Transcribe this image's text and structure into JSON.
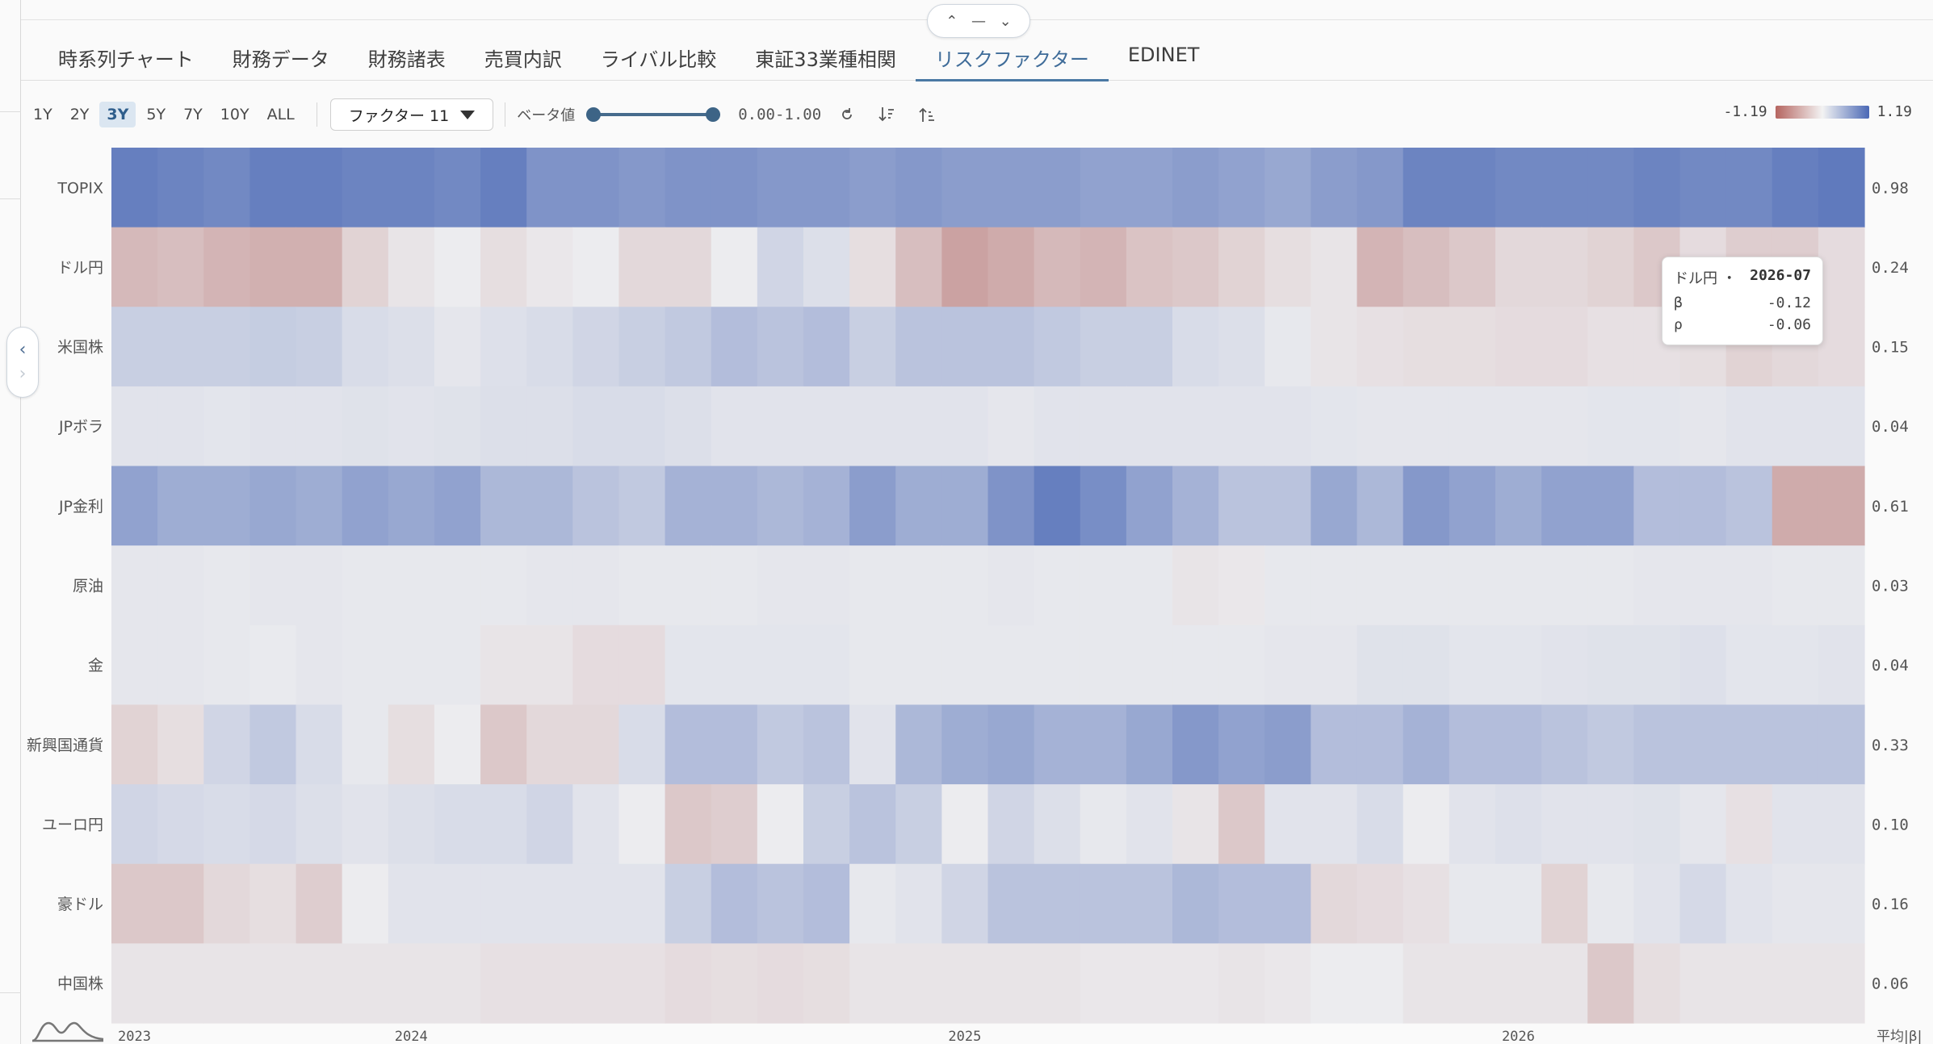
{
  "tabs": [
    {
      "label": "時系列チャート",
      "active": false
    },
    {
      "label": "財務データ",
      "active": false
    },
    {
      "label": "財務諸表",
      "active": false
    },
    {
      "label": "売買内訳",
      "active": false
    },
    {
      "label": "ライバル比較",
      "active": false
    },
    {
      "label": "東証33業種相関",
      "active": false
    },
    {
      "label": "リスクファクター",
      "active": true
    },
    {
      "label": "EDINET",
      "active": false
    }
  ],
  "toolbar": {
    "periods": [
      "1Y",
      "2Y",
      "3Y",
      "5Y",
      "7Y",
      "10Y",
      "ALL"
    ],
    "active_period": "3Y",
    "factor_select": "ファクター 11",
    "beta_label": "ベータ値",
    "range": {
      "min": 0.0,
      "max": 1.0
    },
    "range_text": "0.00-1.00"
  },
  "legend": {
    "min_label": "-1.19",
    "max_label": "1.19",
    "neg_color": "#b56560",
    "mid_color": "#f3f3f3",
    "pos_color": "#4a68b5"
  },
  "tooltip": {
    "factor": "ドル円",
    "dot": "・",
    "date": "2026-07",
    "beta_label": "β",
    "beta": "-0.12",
    "rho_label": "ρ",
    "rho": "-0.06"
  },
  "chart_data": {
    "type": "heatmap",
    "factors": [
      "TOPIX",
      "ドル円",
      "米国株",
      "JPボラ",
      "JP金利",
      "原油",
      "金",
      "新興国通貨",
      "ユーロ円",
      "豪ドル",
      "中国株"
    ],
    "x_labels": [
      "2023",
      "2024",
      "2025",
      "2026"
    ],
    "avg_label": "平均|β|",
    "averages": [
      "0.98",
      "0.24",
      "0.15",
      "0.04",
      "0.61",
      "0.03",
      "0.04",
      "0.33",
      "0.10",
      "0.16",
      "0.06"
    ],
    "scale": [
      -1.19,
      1.19
    ],
    "values": [
      [
        0.95,
        0.9,
        0.85,
        0.95,
        0.95,
        0.9,
        0.9,
        0.85,
        0.95,
        0.75,
        0.75,
        0.7,
        0.75,
        0.75,
        0.7,
        0.7,
        0.65,
        0.7,
        0.65,
        0.65,
        0.65,
        0.6,
        0.6,
        0.65,
        0.6,
        0.55,
        0.65,
        0.7,
        0.9,
        0.9,
        0.85,
        0.85,
        0.85,
        0.9,
        0.85,
        0.85,
        0.95,
        1.0
      ],
      [
        -0.45,
        -0.4,
        -0.5,
        -0.55,
        -0.55,
        -0.2,
        -0.05,
        0.0,
        -0.1,
        -0.03,
        0.0,
        -0.15,
        -0.15,
        0.0,
        0.15,
        0.08,
        -0.1,
        -0.4,
        -0.7,
        -0.6,
        -0.45,
        -0.5,
        -0.35,
        -0.3,
        -0.2,
        -0.1,
        -0.05,
        -0.5,
        -0.4,
        -0.3,
        -0.15,
        -0.15,
        -0.2,
        -0.3,
        -0.12,
        -0.25,
        -0.25,
        -0.12
      ],
      [
        0.2,
        0.2,
        0.2,
        0.22,
        0.2,
        0.1,
        0.08,
        0.03,
        0.07,
        0.1,
        0.15,
        0.2,
        0.25,
        0.35,
        0.3,
        0.35,
        0.2,
        0.3,
        0.3,
        0.3,
        0.25,
        0.2,
        0.2,
        0.1,
        0.08,
        0.02,
        -0.05,
        -0.08,
        -0.1,
        -0.1,
        -0.12,
        -0.12,
        -0.08,
        -0.08,
        -0.1,
        -0.2,
        -0.15,
        -0.12
      ],
      [
        0.05,
        0.05,
        0.04,
        0.05,
        0.05,
        0.06,
        0.05,
        0.06,
        0.08,
        0.08,
        0.1,
        0.1,
        0.08,
        0.05,
        0.05,
        0.05,
        0.05,
        0.05,
        0.05,
        0.03,
        0.05,
        0.05,
        0.05,
        0.05,
        0.05,
        0.05,
        0.04,
        0.03,
        0.03,
        0.03,
        0.03,
        0.03,
        0.04,
        0.04,
        0.03,
        0.05,
        0.05,
        0.05
      ],
      [
        0.6,
        0.5,
        0.5,
        0.55,
        0.5,
        0.6,
        0.55,
        0.6,
        0.4,
        0.4,
        0.3,
        0.25,
        0.45,
        0.45,
        0.4,
        0.45,
        0.65,
        0.5,
        0.5,
        0.75,
        0.95,
        0.8,
        0.6,
        0.45,
        0.3,
        0.3,
        0.55,
        0.4,
        0.7,
        0.6,
        0.5,
        0.6,
        0.6,
        0.35,
        0.35,
        0.3,
        -0.6,
        -0.6
      ],
      [
        0.03,
        0.03,
        0.02,
        0.03,
        0.03,
        0.02,
        0.02,
        0.02,
        0.02,
        0.03,
        0.03,
        0.02,
        0.02,
        0.02,
        0.03,
        0.03,
        0.02,
        0.02,
        0.02,
        0.03,
        0.02,
        0.02,
        0.02,
        -0.05,
        -0.03,
        0.02,
        0.02,
        0.02,
        0.02,
        0.02,
        0.02,
        0.02,
        0.02,
        0.03,
        0.03,
        0.03,
        0.02,
        0.02
      ],
      [
        0.03,
        0.03,
        0.02,
        0.01,
        0.03,
        0.02,
        0.02,
        0.02,
        -0.05,
        -0.05,
        -0.12,
        -0.12,
        0.04,
        0.04,
        0.04,
        0.04,
        0.02,
        0.02,
        0.02,
        0.02,
        0.02,
        0.02,
        0.02,
        0.02,
        0.02,
        0.03,
        0.03,
        0.06,
        0.06,
        0.04,
        0.04,
        0.05,
        0.06,
        0.06,
        0.07,
        0.04,
        0.04,
        0.05
      ],
      [
        -0.2,
        -0.1,
        0.15,
        0.25,
        0.1,
        0.02,
        -0.1,
        0.0,
        -0.3,
        -0.15,
        -0.15,
        0.1,
        0.35,
        0.35,
        0.25,
        0.3,
        0.05,
        0.4,
        0.5,
        0.55,
        0.45,
        0.45,
        0.55,
        0.7,
        0.6,
        0.65,
        0.35,
        0.35,
        0.45,
        0.35,
        0.35,
        0.3,
        0.25,
        0.3,
        0.3,
        0.3,
        0.3,
        0.3
      ],
      [
        0.15,
        0.12,
        0.1,
        0.12,
        0.08,
        0.05,
        0.08,
        0.1,
        0.1,
        0.15,
        0.05,
        0.0,
        -0.3,
        -0.25,
        0.0,
        0.2,
        0.3,
        0.2,
        0.0,
        0.15,
        0.08,
        0.02,
        0.05,
        -0.05,
        -0.3,
        0.05,
        0.05,
        0.1,
        0.0,
        0.05,
        0.07,
        0.05,
        0.05,
        0.06,
        0.03,
        -0.08,
        0.05,
        0.05
      ],
      [
        -0.3,
        -0.3,
        -0.15,
        -0.1,
        -0.25,
        0.0,
        0.05,
        0.05,
        0.05,
        0.05,
        0.05,
        0.05,
        0.2,
        0.35,
        0.3,
        0.35,
        0.02,
        0.05,
        0.15,
        0.3,
        0.3,
        0.3,
        0.3,
        0.4,
        0.35,
        0.35,
        -0.15,
        -0.12,
        -0.08,
        0.02,
        0.02,
        -0.2,
        0.02,
        0.05,
        0.12,
        0.05,
        0.03,
        0.03
      ],
      [
        -0.05,
        -0.05,
        -0.05,
        -0.05,
        -0.05,
        -0.05,
        -0.05,
        -0.05,
        -0.08,
        -0.08,
        -0.08,
        -0.08,
        -0.12,
        -0.1,
        -0.12,
        -0.1,
        -0.05,
        -0.05,
        -0.05,
        -0.05,
        -0.05,
        -0.03,
        -0.03,
        -0.03,
        -0.05,
        -0.03,
        0.0,
        0.0,
        -0.05,
        -0.05,
        -0.05,
        -0.05,
        -0.3,
        -0.1,
        -0.05,
        -0.05,
        -0.05,
        -0.05
      ]
    ]
  }
}
